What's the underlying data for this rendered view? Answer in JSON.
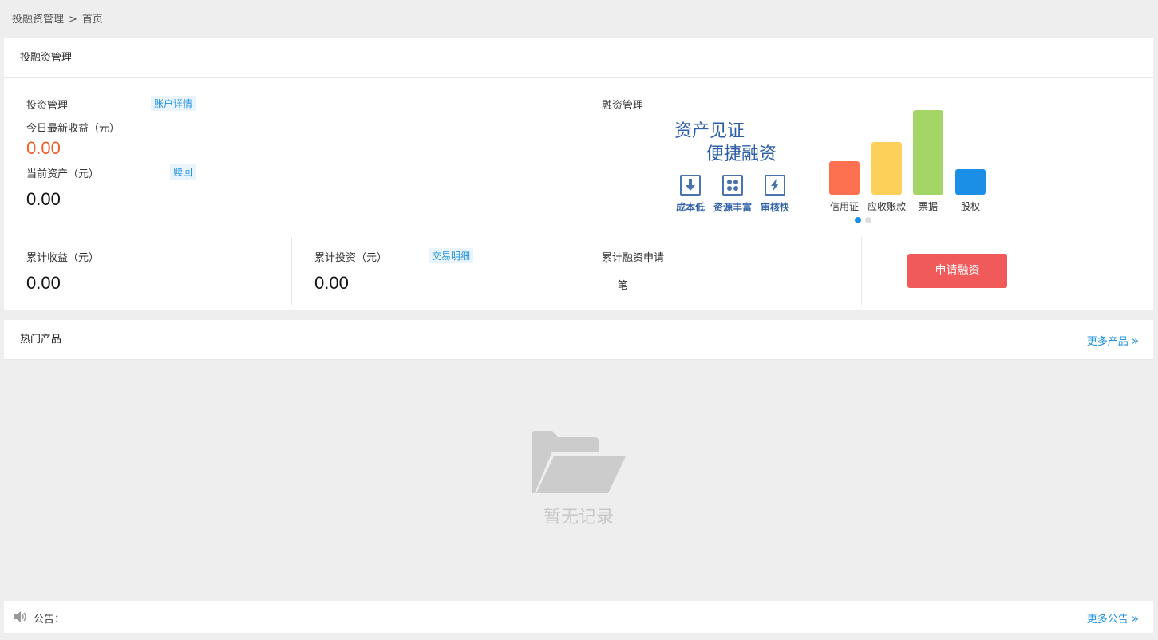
{
  "breadcrumb": {
    "root": "投融资管理",
    "sep": ">",
    "current": "首页"
  },
  "panel_title": "投融资管理",
  "investment": {
    "title": "投资管理",
    "account_detail": "账户详情",
    "today_income_label": "今日最新收益（元）",
    "today_income_value": "0.00",
    "current_assets_label": "当前资产（元）",
    "redeem": "赎回",
    "current_assets_value": "0.00",
    "cumulative_income_label": "累计收益（元）",
    "cumulative_income_value": "0.00",
    "cumulative_invest_label": "累计投资（元）",
    "trade_detail": "交易明细",
    "cumulative_invest_value": "0.00"
  },
  "financing": {
    "title": "融资管理",
    "promo_line1": "资产见证",
    "promo_line2": "便捷融资",
    "features": [
      {
        "label": "成本低",
        "icon": "download-arrow-icon"
      },
      {
        "label": "资源丰富",
        "icon": "grid-icon"
      },
      {
        "label": "审核快",
        "icon": "lightning-icon"
      }
    ],
    "bars": [
      {
        "label": "信用证",
        "color": "#fd7150",
        "level": 0.4
      },
      {
        "label": "应收账款",
        "color": "#fdd159",
        "level": 0.62
      },
      {
        "label": "票据",
        "color": "#a3d667",
        "level": 1.0
      },
      {
        "label": "股权",
        "color": "#1b8ee6",
        "level": 0.3
      }
    ],
    "carousel_active_color": "#1b8ee6",
    "carousel_inactive_color": "#dddddd",
    "cumulative_apply_label": "累计融资申请",
    "cumulative_apply_unit": "笔",
    "apply_button": "申请融资"
  },
  "hot": {
    "title": "热门产品",
    "more": "更多产品"
  },
  "empty": {
    "text": "暂无记录",
    "icon": "folder-icon"
  },
  "notice": {
    "label": "公告：",
    "more": "更多公告",
    "icon": "speaker-icon"
  }
}
